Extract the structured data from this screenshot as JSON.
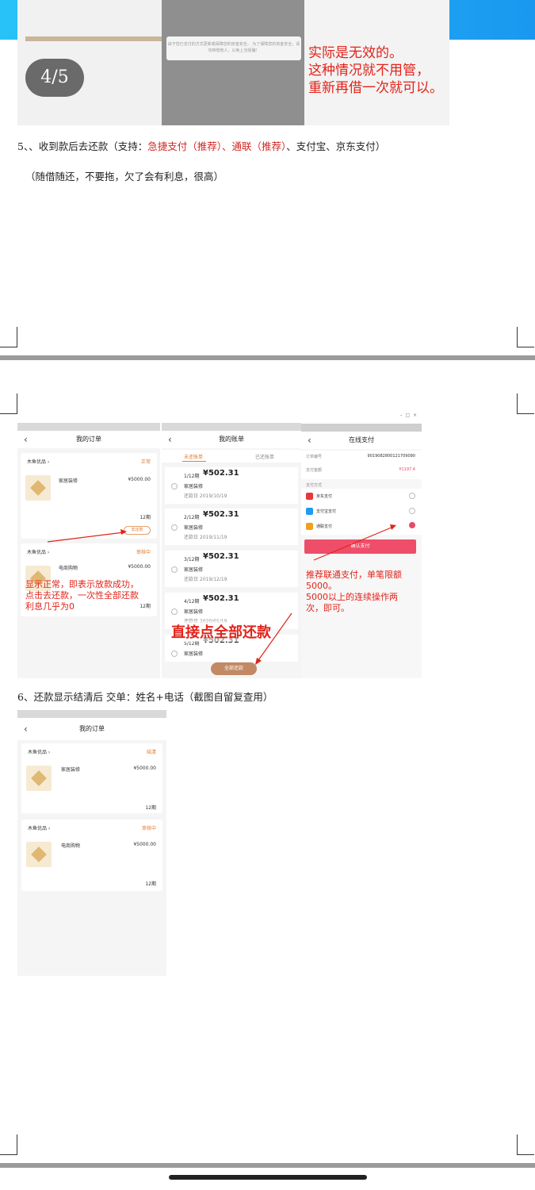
{
  "top": {
    "page_indicator": "4/5",
    "right_note": "实际是无效的。\n这种情况就不用管，\n重新再借一次就可以。",
    "mid_note": "由于您已支付的方式更新或保障您的资金安全，\n为了保障您的资金安全，请勿转借他人，以免上当受骗！"
  },
  "step5": {
    "prefix": "5、、收到款后去还款（支持：",
    "red1": "急捷支付（推荐）、",
    "red2": "通联（推荐）",
    "suffix": "、支付宝、京东支付）",
    "line2": "（随借随还，不要拖，欠了会有利息，很高）"
  },
  "orders_screen": {
    "title": "我的订单",
    "items": [
      {
        "shop": "木鱼优品 ›",
        "status": "正常",
        "product": "家居装修",
        "price": "¥5000.00",
        "periods": "12期",
        "button": "去还款"
      },
      {
        "shop": "木鱼优品 ›",
        "status": "审核中",
        "product": "电商购物",
        "price": "¥5000.00",
        "periods": "12期"
      }
    ],
    "annotation": "显示正常，即表示放款成功，\n点击去还款，一次性全部还款\n利息几乎为0"
  },
  "bills_screen": {
    "title": "我的账单",
    "tabs": [
      "未还账单",
      "已还账单"
    ],
    "items": [
      {
        "period": "1/12期",
        "amount": "¥502.31",
        "name": "家居装修",
        "date": "还款日 2019/10/19"
      },
      {
        "period": "2/12期",
        "amount": "¥502.31",
        "name": "家居装修",
        "date": "还款日 2019/11/19"
      },
      {
        "period": "3/12期",
        "amount": "¥502.31",
        "name": "家居装修",
        "date": "还款日 2019/12/19"
      },
      {
        "period": "4/12期",
        "amount": "¥502.31",
        "name": "家居装修",
        "date": "还款日 2020/01/19"
      },
      {
        "period": "5/12期",
        "amount": "¥502.31",
        "name": "家居装修",
        "date": ""
      }
    ],
    "annotation": "直接点全部还款",
    "button": "全部还款"
  },
  "pay_screen": {
    "title": "在线支付",
    "order_label": "订单编号",
    "order_no": "9019082800121709090",
    "amount_label": "支付金额",
    "amount": "¥1197.4",
    "methods_label": "支付方式",
    "methods": [
      "京东支付",
      "支付宝支付",
      "通联支付"
    ],
    "button": "确认支付",
    "annotation": "推荐联通支付，单笔限额\n5000。\n5000以上的连续操作两\n次，即可。",
    "colors": {
      "jd": "#e4393c",
      "alipay": "#1e9bf0",
      "tonglian": "#f0a020",
      "button": "#ef4e6a"
    }
  },
  "step6": {
    "text": "6、还款显示结清后 交单：姓名+电话（截图自留复查用）"
  },
  "settled_screen": {
    "title": "我的订单",
    "items": [
      {
        "shop": "木鱼优品 ›",
        "status": "结清",
        "product": "家居装修",
        "price": "¥5000.00",
        "periods": "12期"
      },
      {
        "shop": "木鱼优品 ›",
        "status": "审核中",
        "product": "电商购物",
        "price": "¥5000.00",
        "periods": "12期"
      }
    ]
  }
}
